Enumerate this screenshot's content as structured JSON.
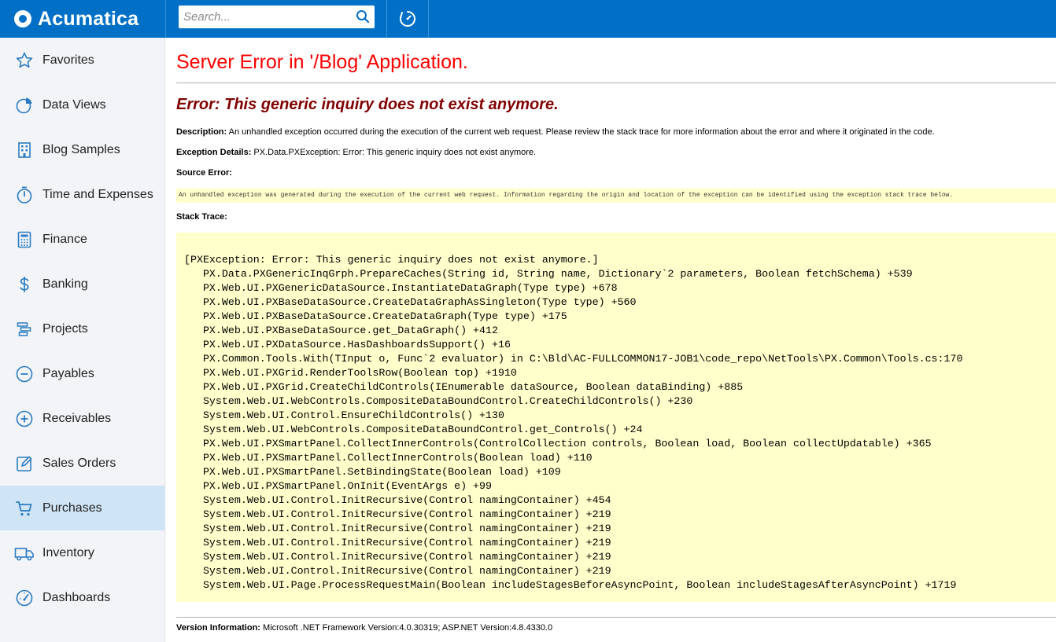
{
  "app": {
    "brand": "Acumatica",
    "accent": "#0070c6"
  },
  "search": {
    "placeholder": "Search..."
  },
  "sidebar": {
    "items": [
      {
        "label": "Favorites",
        "icon": "star-icon"
      },
      {
        "label": "Data Views",
        "icon": "pie-chart-icon"
      },
      {
        "label": "Blog Samples",
        "icon": "building-icon"
      },
      {
        "label": "Time and Expenses",
        "icon": "stopwatch-icon"
      },
      {
        "label": "Finance",
        "icon": "calculator-icon"
      },
      {
        "label": "Banking",
        "icon": "dollar-icon"
      },
      {
        "label": "Projects",
        "icon": "gantt-icon"
      },
      {
        "label": "Payables",
        "icon": "minus-circle-icon"
      },
      {
        "label": "Receivables",
        "icon": "plus-circle-icon"
      },
      {
        "label": "Sales Orders",
        "icon": "pencil-square-icon"
      },
      {
        "label": "Purchases",
        "icon": "cart-icon",
        "active": true
      },
      {
        "label": "Inventory",
        "icon": "truck-icon"
      },
      {
        "label": "Dashboards",
        "icon": "gauge-icon"
      }
    ]
  },
  "error": {
    "page_title": "Server Error in '/Blog' Application.",
    "title": "Error: This generic inquiry does not exist anymore.",
    "description_label": "Description:",
    "description_text": " An unhandled exception occurred during the execution of the current web request. Please review the stack trace for more information about the error and where it originated in the code.",
    "exception_label": "Exception Details:",
    "exception_text": " PX.Data.PXException: Error: This generic inquiry does not exist anymore.",
    "source_error_label": "Source Error:",
    "source_error_text": "An unhandled exception was generated during the execution of the current web request. Information regarding the origin and location of the exception can be identified using the exception stack trace below.",
    "stack_trace_label": "Stack Trace:",
    "stack_trace": "[PXException: Error: This generic inquiry does not exist anymore.]\n   PX.Data.PXGenericInqGrph.PrepareCaches(String id, String name, Dictionary`2 parameters, Boolean fetchSchema) +539\n   PX.Web.UI.PXGenericDataSource.InstantiateDataGraph(Type type) +678\n   PX.Web.UI.PXBaseDataSource.CreateDataGraphAsSingleton(Type type) +560\n   PX.Web.UI.PXBaseDataSource.CreateDataGraph(Type type) +175\n   PX.Web.UI.PXBaseDataSource.get_DataGraph() +412\n   PX.Web.UI.PXDataSource.HasDashboardsSupport() +16\n   PX.Common.Tools.With(TInput o, Func`2 evaluator) in C:\\Bld\\AC-FULLCOMMON17-JOB1\\code_repo\\NetTools\\PX.Common\\Tools.cs:170\n   PX.Web.UI.PXGrid.RenderToolsRow(Boolean top) +1910\n   PX.Web.UI.PXGrid.CreateChildControls(IEnumerable dataSource, Boolean dataBinding) +885\n   System.Web.UI.WebControls.CompositeDataBoundControl.CreateChildControls() +230\n   System.Web.UI.Control.EnsureChildControls() +130\n   System.Web.UI.WebControls.CompositeDataBoundControl.get_Controls() +24\n   PX.Web.UI.PXSmartPanel.CollectInnerControls(ControlCollection controls, Boolean load, Boolean collectUpdatable) +365\n   PX.Web.UI.PXSmartPanel.CollectInnerControls(Boolean load) +110\n   PX.Web.UI.PXSmartPanel.SetBindingState(Boolean load) +109\n   PX.Web.UI.PXSmartPanel.OnInit(EventArgs e) +99\n   System.Web.UI.Control.InitRecursive(Control namingContainer) +454\n   System.Web.UI.Control.InitRecursive(Control namingContainer) +219\n   System.Web.UI.Control.InitRecursive(Control namingContainer) +219\n   System.Web.UI.Control.InitRecursive(Control namingContainer) +219\n   System.Web.UI.Control.InitRecursive(Control namingContainer) +219\n   System.Web.UI.Control.InitRecursive(Control namingContainer) +219\n   System.Web.UI.Page.ProcessRequestMain(Boolean includeStagesBeforeAsyncPoint, Boolean includeStagesAfterAsyncPoint) +1719",
    "version_label": "Version Information:",
    "version_text": " Microsoft .NET Framework Version:4.0.30319; ASP.NET Version:4.8.4330.0"
  }
}
